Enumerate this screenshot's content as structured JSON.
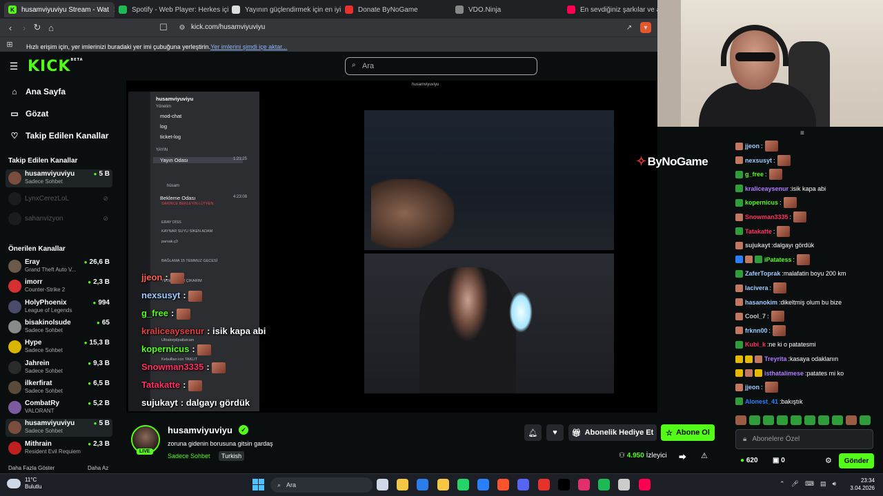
{
  "browser": {
    "tabs": [
      {
        "title": "husamviyuviyu Stream - Wat",
        "icon_color": "#53fc18",
        "icon_char": "K",
        "active": true
      },
      {
        "title": "Spotify - Web Player: Herkes için mü",
        "icon_color": "#1db954",
        "icon_char": "",
        "active": false
      },
      {
        "title": "Yayının güçlendirmek için en iyi yazı",
        "icon_color": "#dddddd",
        "icon_char": "",
        "active": false
      },
      {
        "title": "Donate ByNoGame",
        "icon_color": "#e6322b",
        "icon_char": "",
        "active": false
      },
      {
        "title": "VDO.Ninja",
        "icon_color": "#888888",
        "icon_char": "",
        "active": false
      },
      {
        "title": "En sevdiğiniz şarkılar ve albümle",
        "icon_color": "#ff0050",
        "icon_char": "",
        "active": false
      }
    ],
    "url": "kick.com/husamviyuviyu",
    "bookmark_message": "Hızlı erişim için, yer imlerinizi buradaki yer imi çubuğuna yerleştirin. ",
    "bookmark_link": "Yer imlerini şimdi içe aktar..."
  },
  "header": {
    "logo": "KICK",
    "logo_beta": "BETA",
    "search_placeholder": "Ara"
  },
  "sidebar": {
    "nav": [
      {
        "label": "Ana Sayfa",
        "icon": "home-icon"
      },
      {
        "label": "Gözat",
        "icon": "browse-icon"
      },
      {
        "label": "Takip Edilen Kanallar",
        "icon": "heart-icon"
      }
    ],
    "followed_title": "Takip Edilen Kanallar",
    "followed": [
      {
        "name": "husamviyuviyu",
        "category": "Sadece Sohbet",
        "viewers": "5 B",
        "online": true,
        "color": "#7a4e3d"
      },
      {
        "name": "LynxCerezLoL",
        "category": "",
        "viewers": "",
        "online": false,
        "color": "#333"
      },
      {
        "name": "sahanvizyon",
        "category": "",
        "viewers": "",
        "online": false,
        "color": "#333"
      }
    ],
    "recommended_title": "Önerilen Kanallar",
    "recommended": [
      {
        "name": "Eray",
        "category": "Grand Theft Auto V...",
        "viewers": "26,6 B",
        "color": "#6b5a4a"
      },
      {
        "name": "imorr",
        "category": "Counter-Strike 2",
        "viewers": "2,3 B",
        "color": "#d63030"
      },
      {
        "name": "HolyPhoenix",
        "category": "League of Legends",
        "viewers": "994",
        "color": "#4a4a6a"
      },
      {
        "name": "bisakinolsude",
        "category": "Sadece Sohbet",
        "viewers": "65",
        "color": "#8a8a8a"
      },
      {
        "name": "Hype",
        "category": "Sadece Sohbet",
        "viewers": "15,3 B",
        "color": "#d9b400"
      },
      {
        "name": "Jahrein",
        "category": "Sadece Sohbet",
        "viewers": "9,3 B",
        "color": "#2a2a2a"
      },
      {
        "name": "ilkerfirat",
        "category": "Sadece Sohbet",
        "viewers": "6,5 B",
        "color": "#5a4a3a"
      },
      {
        "name": "CombatRy",
        "category": "VALORANT",
        "viewers": "5,2 B",
        "color": "#7b5aa0"
      },
      {
        "name": "husamviyuviyu",
        "category": "Sadece Sohbet",
        "viewers": "5 B",
        "color": "#7a4e3d"
      },
      {
        "name": "Mithrain",
        "category": "Resident Evil Requiem",
        "viewers": "2,3 B",
        "color": "#c02020"
      }
    ],
    "show_more": "Daha Fazla Göster",
    "show_less": "Daha Az"
  },
  "video": {
    "mini_title": "husamviyuviyu",
    "sponsor": "ByNoGame",
    "discord": {
      "server": "husamviyuviyu",
      "category_mgmt": "Yönetim",
      "channels": [
        "mod-chat",
        "log",
        "ticket-log"
      ],
      "category_live": "YAYIN",
      "voice1": "Yayın Odası",
      "voice1_time": "1:21:25",
      "voice2": "Bekleme Odası",
      "voice2_time": "4:23:08",
      "members": [
        "hüsam",
        "SAKİNCE BEKLEYİN LÜTFEN",
        "ERAY DİSS",
        "KAYNAR SUYU SİKEN ADAM",
        "parsak.ç0",
        "BAĞLAMA 15 TEMMUZ GECESİ",
        "YEDE GEĞİR ÇIKARIM",
        "Ultratorpilpatlatcam",
        "Kebulllan icin TAKLIT"
      ]
    },
    "overlay_chat": [
      {
        "user": "jjeon",
        "text": "",
        "color": "#fe5f55",
        "emote": true
      },
      {
        "user": "nexsusyt",
        "text": "",
        "color": "#9ecbff",
        "emote": true
      },
      {
        "user": "g_free",
        "text": "",
        "color": "#53fc18",
        "emote": true
      },
      {
        "user": "kraliceaysenur",
        "text": "isik kapa abi",
        "color": "#e04040",
        "emote": false
      },
      {
        "user": "kopernicus",
        "text": "",
        "color": "#53fc18",
        "emote": true
      },
      {
        "user": "Snowman3335",
        "text": "",
        "color": "#ff3060",
        "emote": true
      },
      {
        "user": "Tatakatte",
        "text": "",
        "color": "#ff3060",
        "emote": true
      },
      {
        "user": "sujukayt",
        "text": "dalgayı gördük",
        "color": "#ffffff",
        "emote": false
      }
    ]
  },
  "stream": {
    "name": "husamviyuviyu",
    "live": "LIVE",
    "title": "zoruna gidenin borusuna gitsin gardaş",
    "category": "Sadece Sohbet",
    "tag": "Turkish",
    "gift_label": "Abonelik Hediye Et",
    "subscribe_label": "Abone Ol",
    "viewers_count": "4.950",
    "viewers_label": "İzleyici"
  },
  "chat": {
    "messages": [
      {
        "user": "jjeon",
        "text": "",
        "color": "#9ecbff",
        "emote": true,
        "badges": [
          "#c27860"
        ]
      },
      {
        "user": "nexsusyt",
        "text": "",
        "color": "#9ecbff",
        "emote": true,
        "badges": [
          "#c27860"
        ]
      },
      {
        "user": "g_free",
        "text": "",
        "color": "#53fc18",
        "emote": true,
        "badges": [
          "#2f9e3a"
        ]
      },
      {
        "user": "kraliceaysenur",
        "text": "isik kapa abi",
        "color": "#b07cff",
        "emote": false,
        "badges": [
          "#2f9e3a"
        ]
      },
      {
        "user": "kopernicus",
        "text": "",
        "color": "#53fc18",
        "emote": true,
        "badges": [
          "#2f9e3a"
        ]
      },
      {
        "user": "Snowman3335",
        "text": "",
        "color": "#ff3060",
        "emote": true,
        "badges": [
          "#c27860"
        ]
      },
      {
        "user": "Tatakatte",
        "text": "",
        "color": "#ff3060",
        "emote": true,
        "badges": [
          "#2f9e3a"
        ]
      },
      {
        "user": "sujukayt",
        "text": "dalgayı gördük",
        "color": "#c8c8c8",
        "emote": false,
        "badges": [
          "#c27860"
        ]
      },
      {
        "user": "iPatatess",
        "text": "",
        "color": "#53fc18",
        "emote": true,
        "badges": [
          "#2a7fff",
          "#c27860",
          "#2f9e3a"
        ]
      },
      {
        "user": "ZaferToprak",
        "text": "malafatin boyu 200 km",
        "color": "#9ecbff",
        "emote": false,
        "badges": [
          "#2f9e3a"
        ]
      },
      {
        "user": "lacivera",
        "text": "",
        "color": "#9ecbff",
        "emote": true,
        "badges": [
          "#c27860"
        ]
      },
      {
        "user": "hasanokim",
        "text": "dikeltmiş olum bu bize",
        "color": "#9ecbff",
        "emote": false,
        "badges": [
          "#c27860"
        ]
      },
      {
        "user": "Cool_7",
        "text": "",
        "color": "#c8c8c8",
        "emote": true,
        "badges": [
          "#c27860"
        ]
      },
      {
        "user": "frknn00",
        "text": "",
        "color": "#9ecbff",
        "emote": true,
        "badges": [
          "#c27860"
        ]
      },
      {
        "user": "Kubi_k",
        "text": "ne ki o patatesmi",
        "color": "#ff3060",
        "emote": false,
        "badges": [
          "#2f9e3a"
        ]
      },
      {
        "user": "Treyrita",
        "text": "kasaya odaklanın",
        "color": "#b07cff",
        "emote": false,
        "badges": [
          "#e6b800",
          "#e6b800",
          "#c27860"
        ]
      },
      {
        "user": "isthatalimese",
        "text": "patates mi ko",
        "color": "#b07cff",
        "emote": false,
        "badges": [
          "#e6b800",
          "#c27860",
          "#e6b800"
        ]
      },
      {
        "user": "jjeon",
        "text": "",
        "color": "#9ecbff",
        "emote": true,
        "badges": [
          "#c27860"
        ]
      },
      {
        "user": "Alonest_41",
        "text": "bakıştık",
        "color": "#2a7fff",
        "emote": false,
        "badges": [
          "#2f9e3a"
        ]
      }
    ],
    "input_placeholder": "Abonelere Özel",
    "points": "620",
    "drops": "0",
    "send_label": "Gönder"
  },
  "taskbar": {
    "temp": "11°C",
    "weather": "Bulutlu",
    "search": "Ara",
    "time": "23:34",
    "date": "3.04.2026"
  }
}
